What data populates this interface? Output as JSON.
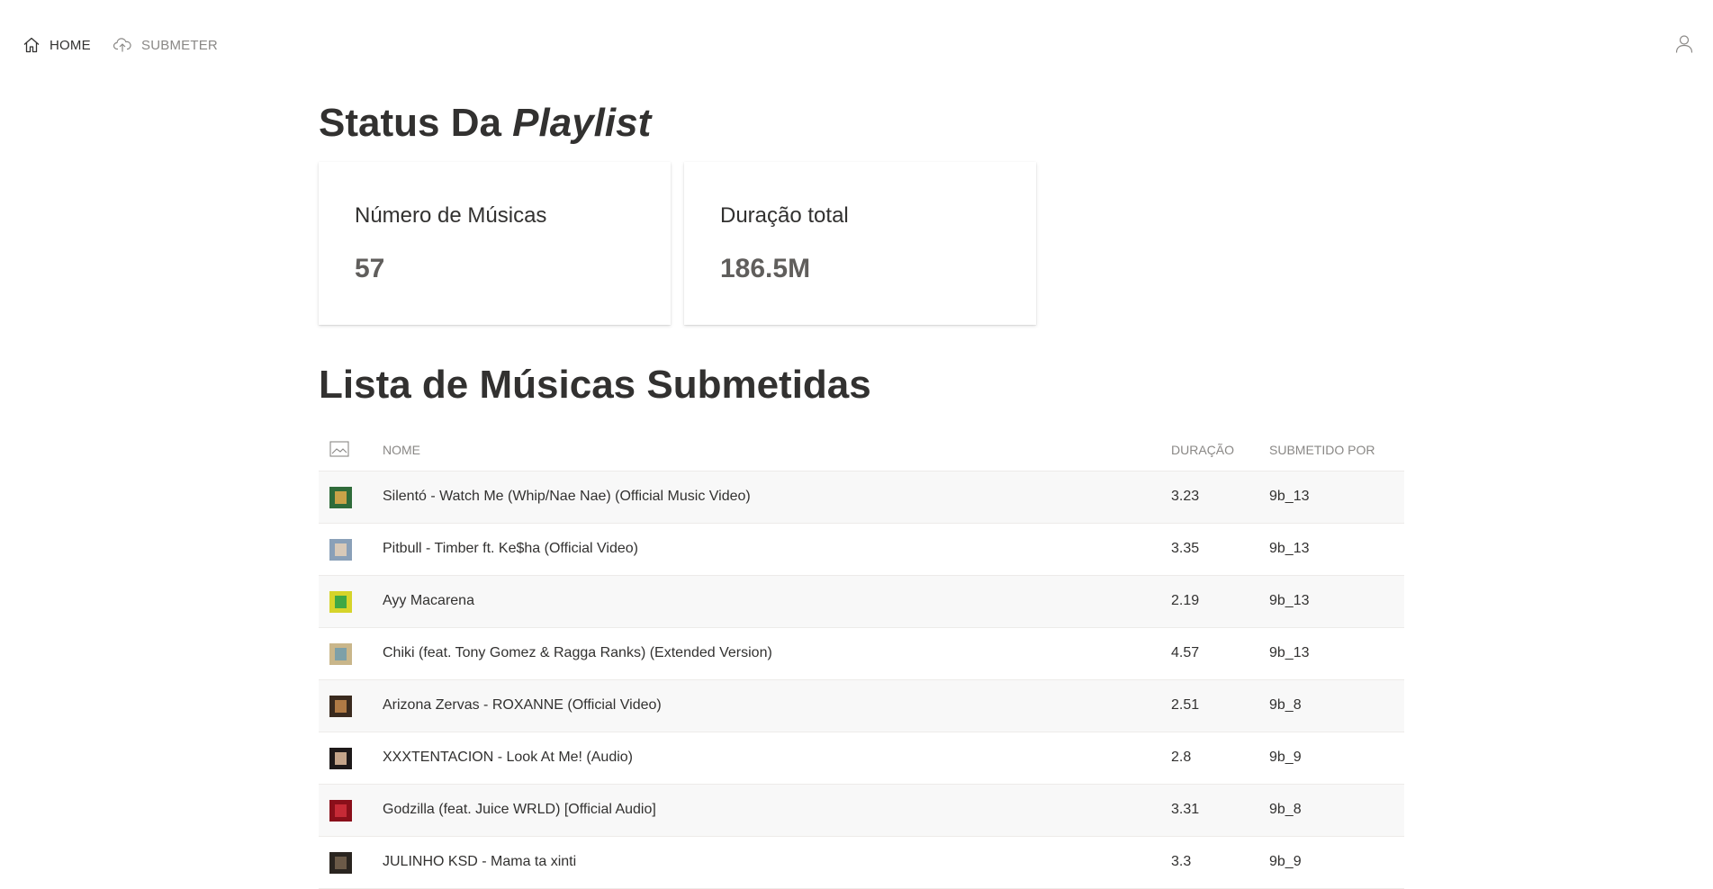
{
  "nav": {
    "home_label": "HOME",
    "submit_label": "SUBMETER"
  },
  "status": {
    "title_plain": "Status Da ",
    "title_italic": "Playlist",
    "cards": [
      {
        "label": "Número de Músicas",
        "value": "57"
      },
      {
        "label": "Duração total",
        "value": "186.5M"
      }
    ]
  },
  "list": {
    "title": "Lista de Músicas Submetidas",
    "headers": {
      "name": "NOME",
      "duration": "DURAÇÃO",
      "submitted_by": "SUBMETIDO POR"
    },
    "rows": [
      {
        "name": "Silentó - Watch Me (Whip/Nae Nae) (Official Music Video)",
        "duration": "3.23",
        "by": "9b_13",
        "thumb_colors": [
          "#2f6b3a",
          "#c9a248"
        ]
      },
      {
        "name": "Pitbull - Timber ft. Ke$ha (Official Video)",
        "duration": "3.35",
        "by": "9b_13",
        "thumb_colors": [
          "#8aa0b8",
          "#d8c9b8"
        ]
      },
      {
        "name": "Ayy Macarena",
        "duration": "2.19",
        "by": "9b_13",
        "thumb_colors": [
          "#d6d42a",
          "#3ea845"
        ]
      },
      {
        "name": "Chiki (feat. Tony Gomez & Ragga Ranks) (Extended Version)",
        "duration": "4.57",
        "by": "9b_13",
        "thumb_colors": [
          "#c9b68a",
          "#7da0a8"
        ]
      },
      {
        "name": "Arizona Zervas - ROXANNE (Official Video)",
        "duration": "2.51",
        "by": "9b_8",
        "thumb_colors": [
          "#3a2a1e",
          "#b07a45"
        ]
      },
      {
        "name": "XXXTENTACION - Look At Me! (Audio)",
        "duration": "2.8",
        "by": "9b_9",
        "thumb_colors": [
          "#1e1a1a",
          "#c4a58a"
        ]
      },
      {
        "name": "Godzilla (feat. Juice WRLD) [Official Audio]",
        "duration": "3.31",
        "by": "9b_8",
        "thumb_colors": [
          "#8a0f1a",
          "#c62a36"
        ]
      },
      {
        "name": "JULINHO KSD - Mama ta xinti",
        "duration": "3.3",
        "by": "9b_9",
        "thumb_colors": [
          "#2a2520",
          "#6b5a48"
        ]
      }
    ]
  }
}
